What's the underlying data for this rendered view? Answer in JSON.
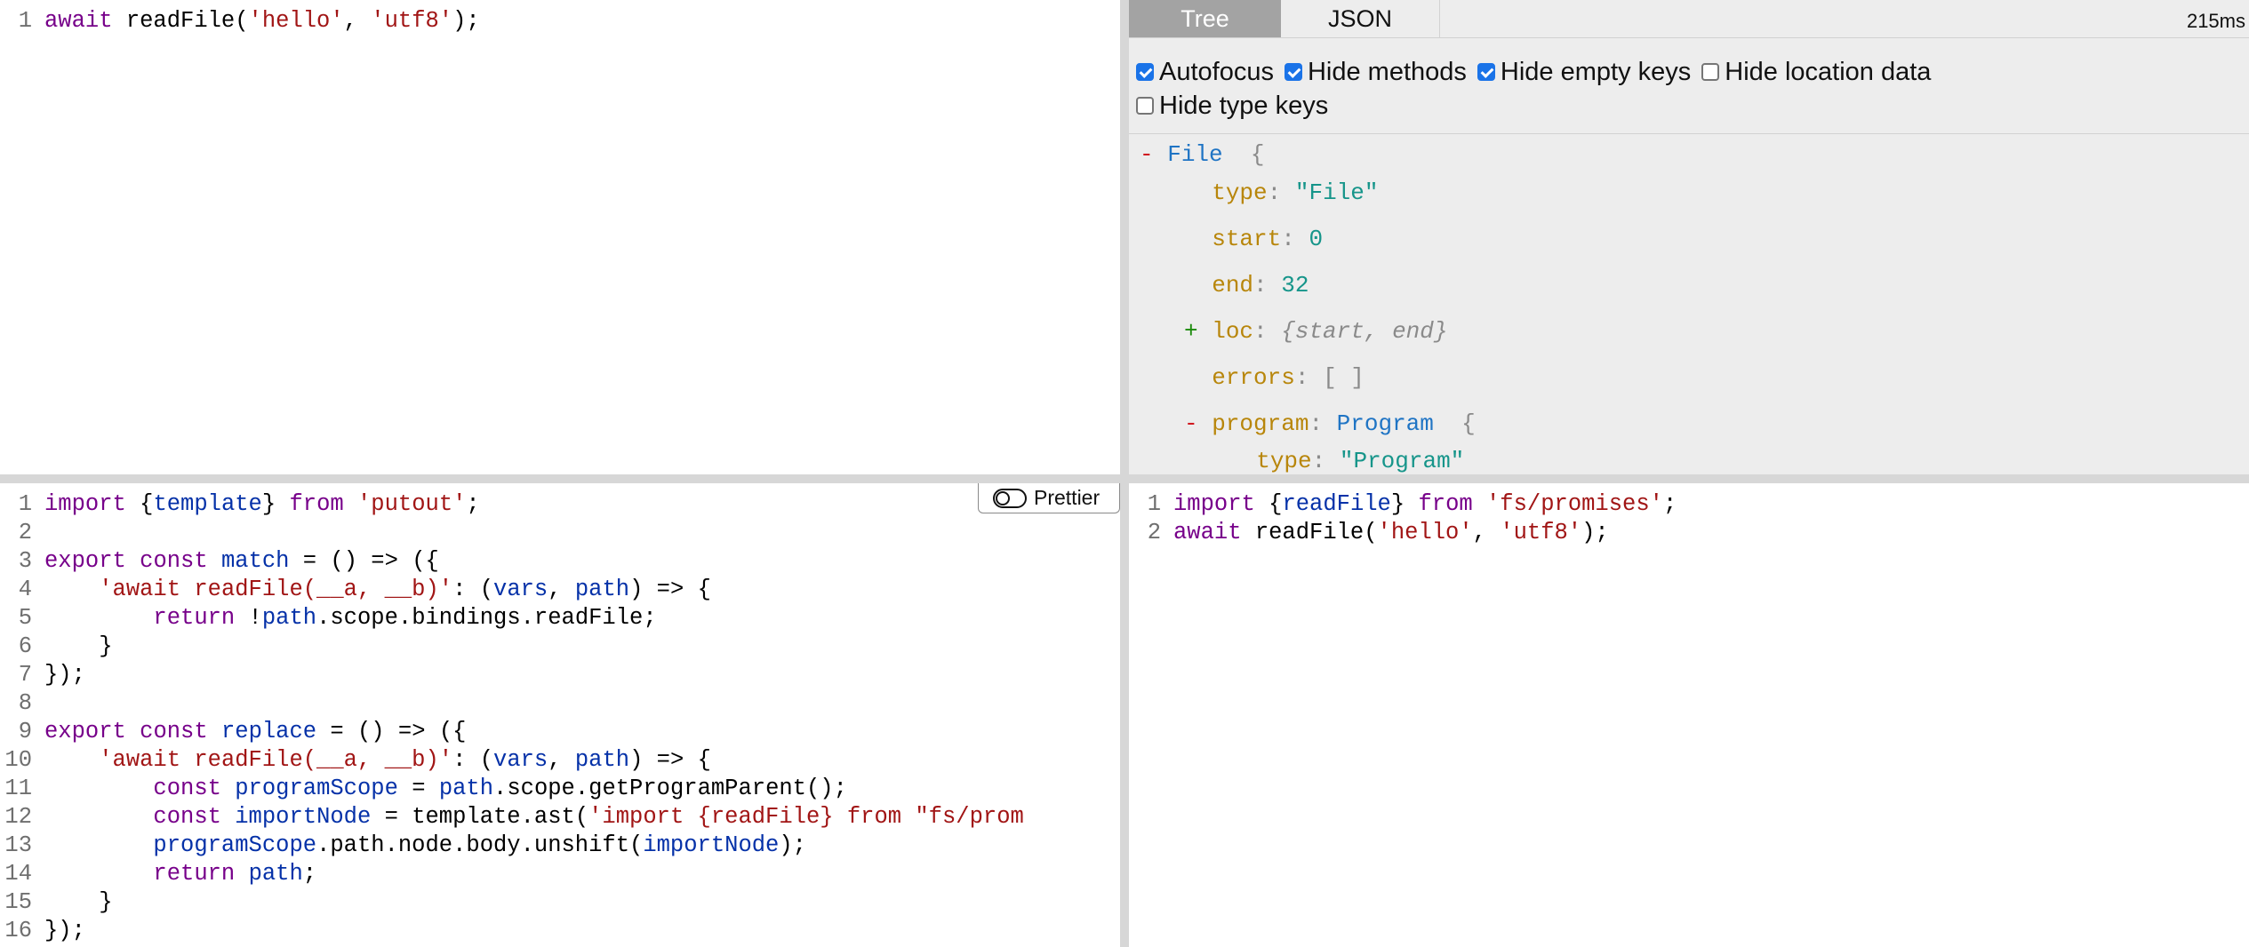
{
  "source_editor": {
    "lines": [
      [
        {
          "t": "await",
          "c": "kw"
        },
        {
          "t": " readFile(",
          "c": "plain"
        },
        {
          "t": "'hello'",
          "c": "str"
        },
        {
          "t": ", ",
          "c": "plain"
        },
        {
          "t": "'utf8'",
          "c": "str"
        },
        {
          "t": ");",
          "c": "plain"
        }
      ]
    ]
  },
  "ast_panel": {
    "tabs": [
      "Tree",
      "JSON"
    ],
    "active_tab": "Tree",
    "timing": "215ms",
    "options": [
      {
        "label": "Autofocus",
        "checked": true
      },
      {
        "label": "Hide methods",
        "checked": true
      },
      {
        "label": "Hide empty keys",
        "checked": true
      },
      {
        "label": "Hide location data",
        "checked": false
      },
      {
        "label": "Hide type keys",
        "checked": false
      }
    ],
    "tree": [
      {
        "toggle": "-",
        "key": "",
        "type": "File",
        "brace": "{",
        "indent": 0
      },
      {
        "toggle": "",
        "key": "type",
        "value": "\"File\"",
        "vkind": "str",
        "indent": 1
      },
      {
        "toggle": "",
        "key": "start",
        "value": "0",
        "vkind": "num",
        "indent": 1
      },
      {
        "toggle": "",
        "key": "end",
        "value": "32",
        "vkind": "num",
        "indent": 1
      },
      {
        "toggle": "+",
        "key": "loc",
        "summary": "{start, end}",
        "indent": 1
      },
      {
        "toggle": "",
        "key": "errors",
        "value": "[ ]",
        "vkind": "punct",
        "indent": 1
      },
      {
        "toggle": "-",
        "key": "program",
        "type": "Program",
        "brace": "{",
        "indent": 1
      },
      {
        "toggle": "",
        "key": "type",
        "value": "\"Program\"",
        "vkind": "str",
        "indent": 2
      }
    ]
  },
  "transform_editor": {
    "prettier_label": "Prettier",
    "lines": [
      [
        {
          "t": "import",
          "c": "kw"
        },
        {
          "t": " {",
          "c": "plain"
        },
        {
          "t": "template",
          "c": "var"
        },
        {
          "t": "} ",
          "c": "plain"
        },
        {
          "t": "from",
          "c": "kw"
        },
        {
          "t": " ",
          "c": "plain"
        },
        {
          "t": "'putout'",
          "c": "str"
        },
        {
          "t": ";",
          "c": "plain"
        }
      ],
      [],
      [
        {
          "t": "export",
          "c": "kw"
        },
        {
          "t": " ",
          "c": "plain"
        },
        {
          "t": "const",
          "c": "kw"
        },
        {
          "t": " ",
          "c": "plain"
        },
        {
          "t": "match",
          "c": "def"
        },
        {
          "t": " = () => ({",
          "c": "plain"
        }
      ],
      [
        {
          "t": "    ",
          "c": "plain"
        },
        {
          "t": "'await readFile(__a, __b)'",
          "c": "str"
        },
        {
          "t": ": (",
          "c": "plain"
        },
        {
          "t": "vars",
          "c": "var"
        },
        {
          "t": ", ",
          "c": "plain"
        },
        {
          "t": "path",
          "c": "var"
        },
        {
          "t": ") => {",
          "c": "plain"
        }
      ],
      [
        {
          "t": "        ",
          "c": "plain"
        },
        {
          "t": "return",
          "c": "kw"
        },
        {
          "t": " !",
          "c": "plain"
        },
        {
          "t": "path",
          "c": "var"
        },
        {
          "t": ".scope.bindings.readFile;",
          "c": "plain"
        }
      ],
      [
        {
          "t": "    }",
          "c": "plain"
        }
      ],
      [
        {
          "t": "});",
          "c": "plain"
        }
      ],
      [],
      [
        {
          "t": "export",
          "c": "kw"
        },
        {
          "t": " ",
          "c": "plain"
        },
        {
          "t": "const",
          "c": "kw"
        },
        {
          "t": " ",
          "c": "plain"
        },
        {
          "t": "replace",
          "c": "def"
        },
        {
          "t": " = () => ({",
          "c": "plain"
        }
      ],
      [
        {
          "t": "    ",
          "c": "plain"
        },
        {
          "t": "'await readFile(__a, __b)'",
          "c": "str"
        },
        {
          "t": ": (",
          "c": "plain"
        },
        {
          "t": "vars",
          "c": "var"
        },
        {
          "t": ", ",
          "c": "plain"
        },
        {
          "t": "path",
          "c": "var"
        },
        {
          "t": ") => {",
          "c": "plain"
        }
      ],
      [
        {
          "t": "        ",
          "c": "plain"
        },
        {
          "t": "const",
          "c": "kw"
        },
        {
          "t": " ",
          "c": "plain"
        },
        {
          "t": "programScope",
          "c": "def"
        },
        {
          "t": " = ",
          "c": "plain"
        },
        {
          "t": "path",
          "c": "var"
        },
        {
          "t": ".scope.getProgramParent();",
          "c": "plain"
        }
      ],
      [
        {
          "t": "        ",
          "c": "plain"
        },
        {
          "t": "const",
          "c": "kw"
        },
        {
          "t": " ",
          "c": "plain"
        },
        {
          "t": "importNode",
          "c": "def"
        },
        {
          "t": " = template.ast(",
          "c": "plain"
        },
        {
          "t": "'import {readFile} from \"fs/prom",
          "c": "str"
        }
      ],
      [
        {
          "t": "        ",
          "c": "plain"
        },
        {
          "t": "programScope",
          "c": "var"
        },
        {
          "t": ".path.node.body.unshift(",
          "c": "plain"
        },
        {
          "t": "importNode",
          "c": "var"
        },
        {
          "t": ");",
          "c": "plain"
        }
      ],
      [
        {
          "t": "        ",
          "c": "plain"
        },
        {
          "t": "return",
          "c": "kw"
        },
        {
          "t": " ",
          "c": "plain"
        },
        {
          "t": "path",
          "c": "var"
        },
        {
          "t": ";",
          "c": "plain"
        }
      ],
      [
        {
          "t": "    }",
          "c": "plain"
        }
      ],
      [
        {
          "t": "});",
          "c": "plain"
        }
      ]
    ]
  },
  "output_editor": {
    "lines": [
      [
        {
          "t": "import",
          "c": "kw"
        },
        {
          "t": " {",
          "c": "plain"
        },
        {
          "t": "readFile",
          "c": "var"
        },
        {
          "t": "} ",
          "c": "plain"
        },
        {
          "t": "from",
          "c": "kw"
        },
        {
          "t": " ",
          "c": "plain"
        },
        {
          "t": "'fs/promises'",
          "c": "str"
        },
        {
          "t": ";",
          "c": "plain"
        }
      ],
      [
        {
          "t": "await",
          "c": "kw"
        },
        {
          "t": " readFile(",
          "c": "plain"
        },
        {
          "t": "'hello'",
          "c": "str"
        },
        {
          "t": ", ",
          "c": "plain"
        },
        {
          "t": "'utf8'",
          "c": "str"
        },
        {
          "t": ");",
          "c": "plain"
        }
      ]
    ]
  },
  "colors": {
    "keyword": "#77008a",
    "string": "#a11515",
    "variable": "#0531a8",
    "ast_key": "#b8860b",
    "ast_type": "#1f74c4",
    "ast_value": "#16958a"
  }
}
